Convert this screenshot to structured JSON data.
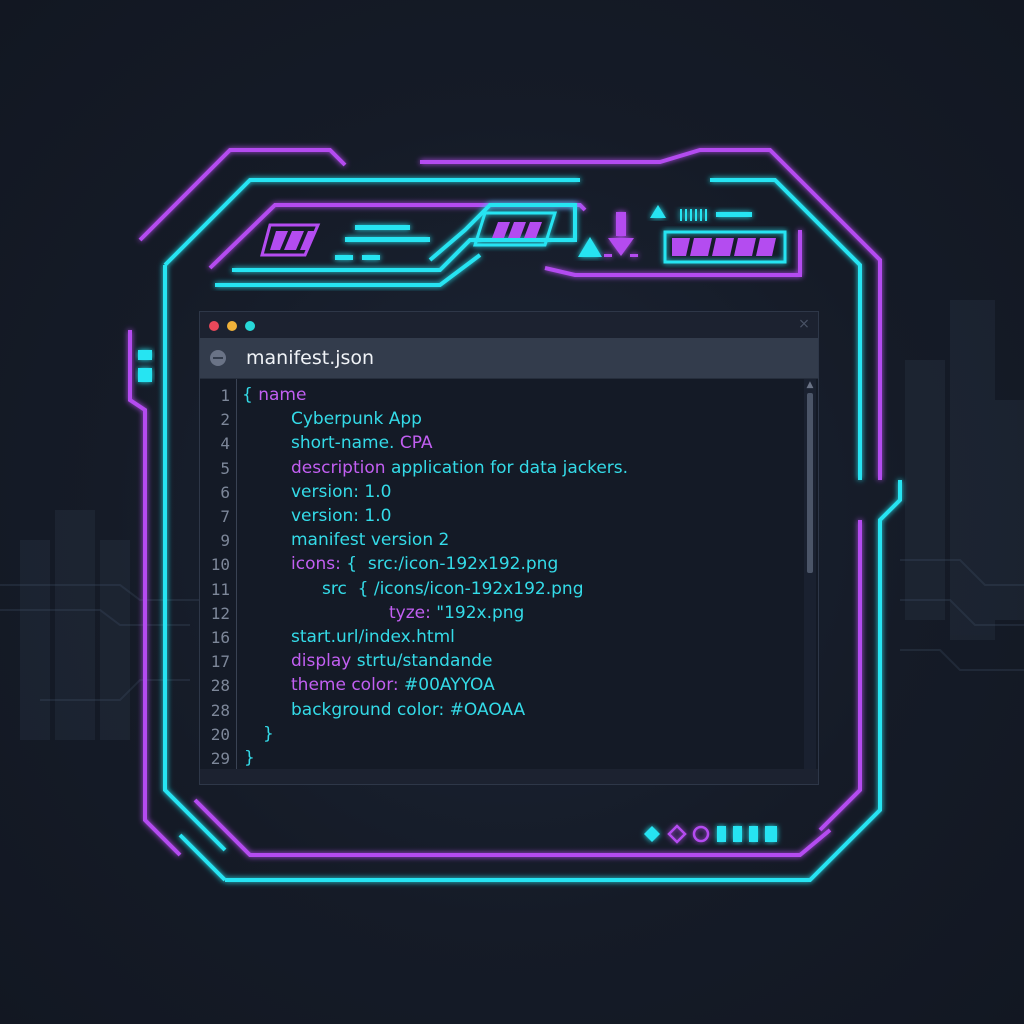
{
  "window": {
    "tab_title": "manifest.json",
    "controls": [
      "close-dot",
      "minimize-dot",
      "maximize-dot"
    ],
    "close_glyph": "⨯"
  },
  "editor": {
    "lines": [
      {
        "num": "1",
        "tokens": [
          {
            "t": "{ ",
            "c": "c"
          },
          {
            "t": "name",
            "c": "m"
          }
        ]
      },
      {
        "num": "2",
        "tokens": [
          {
            "t": "Cyberpunk App",
            "c": "c"
          }
        ]
      },
      {
        "num": "4",
        "tokens": [
          {
            "t": "short-name. ",
            "c": "c"
          },
          {
            "t": "CPA",
            "c": "m"
          }
        ]
      },
      {
        "num": "5",
        "tokens": [
          {
            "t": "description ",
            "c": "m"
          },
          {
            "t": "application for data jackers.",
            "c": "c"
          }
        ]
      },
      {
        "num": "6",
        "tokens": [
          {
            "t": "version: 1.0",
            "c": "c"
          }
        ]
      },
      {
        "num": "7",
        "tokens": [
          {
            "t": "version: 1.0",
            "c": "c"
          }
        ]
      },
      {
        "num": "9",
        "tokens": [
          {
            "t": "manifest version 2",
            "c": "c"
          }
        ]
      },
      {
        "num": "10",
        "tokens": [
          {
            "t": "icons:",
            "c": "m"
          },
          {
            "t": " {  src:/icon-192x192.png",
            "c": "c"
          }
        ]
      },
      {
        "num": "11",
        "tokens": [
          {
            "t": "src  { /icons/icon-192x192.png",
            "c": "c"
          }
        ]
      },
      {
        "num": "12",
        "tokens": [
          {
            "t": "tyze:",
            "c": "m"
          },
          {
            "t": " \"192x.png",
            "c": "c"
          }
        ]
      },
      {
        "num": "16",
        "tokens": [
          {
            "t": "start.url/index.html",
            "c": "c"
          }
        ]
      },
      {
        "num": "17",
        "tokens": [
          {
            "t": "display ",
            "c": "m"
          },
          {
            "t": "strtu/standande",
            "c": "c"
          }
        ]
      },
      {
        "num": "28",
        "tokens": [
          {
            "t": "theme color: ",
            "c": "m"
          },
          {
            "t": "#00AYYOA",
            "c": "c"
          }
        ]
      },
      {
        "num": "28",
        "tokens": [
          {
            "t": "background color: ",
            "c": "c"
          },
          {
            "t": "#OAOAA",
            "c": "c"
          }
        ]
      },
      {
        "num": "20",
        "tokens": [
          {
            "t": "}",
            "c": "c"
          }
        ]
      },
      {
        "num": "29",
        "tokens": [
          {
            "t": "}",
            "c": "c"
          }
        ]
      }
    ]
  },
  "theme": {
    "accent_cyan": "#27e4f2",
    "accent_magenta": "#b44cf0",
    "background": "#141a26"
  },
  "icons": [
    "down-arrow-icon",
    "triangle-icon",
    "diamond-icon",
    "circle-icon"
  ]
}
